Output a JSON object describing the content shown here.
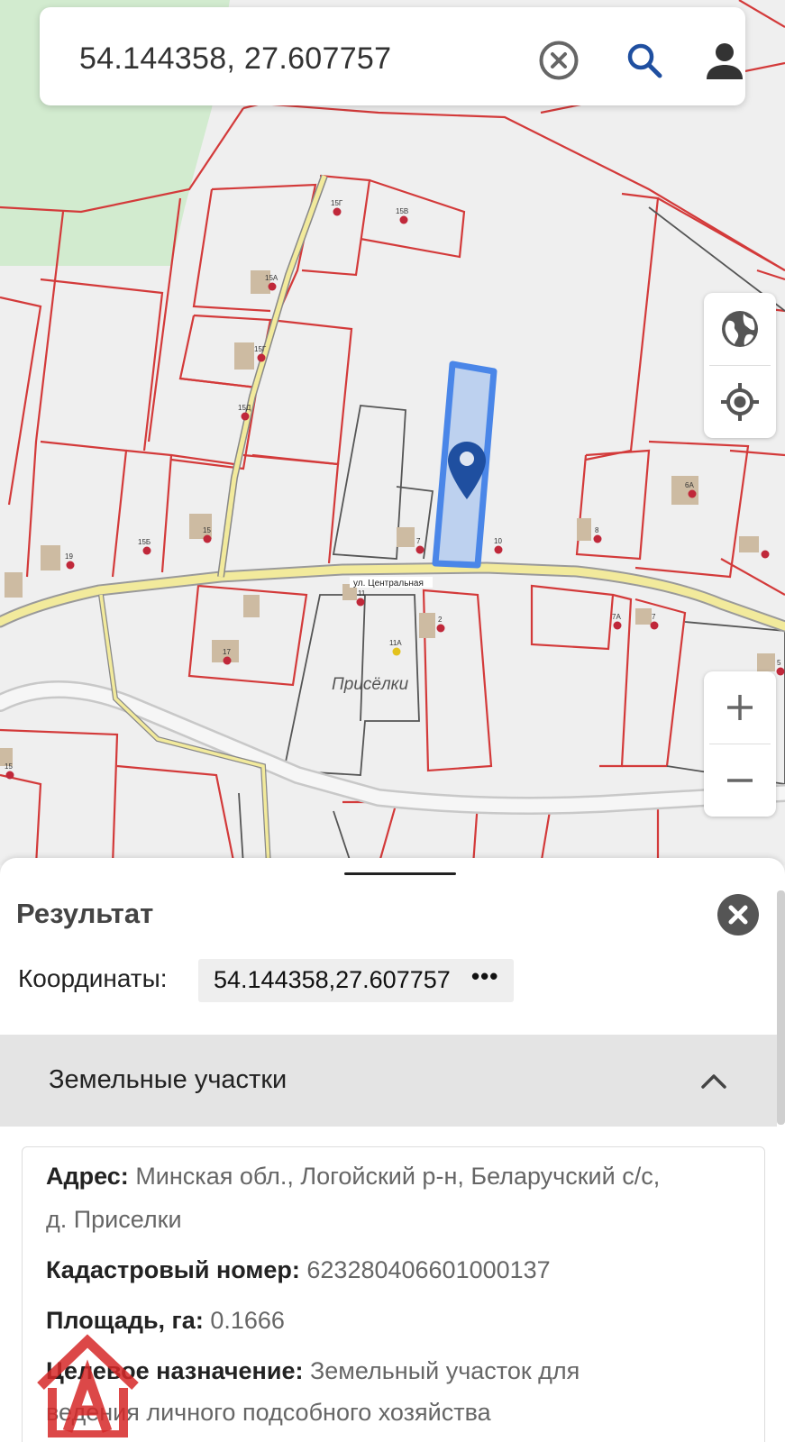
{
  "search": {
    "value": "54.144358, 27.607757"
  },
  "icons": {
    "clear": "clear-circle-icon",
    "search": "search-icon",
    "user": "user-icon",
    "globe": "globe-icon",
    "locate": "crosshair-icon",
    "zoom_in": "plus-icon",
    "zoom_out": "minus-icon",
    "close": "close-icon",
    "chevron": "chevron-up-icon",
    "pin": "map-pin-icon"
  },
  "map": {
    "street_label": "ул. Центральная",
    "village_label": "Присёлки",
    "house_numbers": [
      "15Г",
      "15В",
      "15А",
      "15Г",
      "15Д",
      "15Б",
      "15",
      "19",
      "7",
      "10",
      "8",
      "6А",
      "11",
      "11А",
      "2",
      "17",
      "7А",
      "7",
      "5",
      "15"
    ]
  },
  "colors": {
    "parcel_border": "#d33a3a",
    "road_fill": "#f2ea9c",
    "selection": "#4a86e8",
    "pin": "#1f4fa0",
    "forest": "#d2ebcf"
  },
  "panel": {
    "title": "Результат",
    "coords_label": "Координаты:",
    "coords_value": "54.144358,27.607757",
    "coords_more": "•••",
    "section": "Земельные участки",
    "fields": [
      {
        "key": "Адрес:",
        "value": " Минская обл., Логойский р-н, Беларучский с/с,"
      },
      {
        "key": "",
        "value": "д. Приселки"
      },
      {
        "key": "Кадастровый номер:",
        "value": " 623280406601000137"
      },
      {
        "key": "Площадь, га:",
        "value": " 0.1666"
      },
      {
        "key": "Целевое назначение:",
        "value": " Земельный участок для"
      },
      {
        "key": "",
        "value": "ведения личного подсобного хозяйства"
      }
    ]
  }
}
